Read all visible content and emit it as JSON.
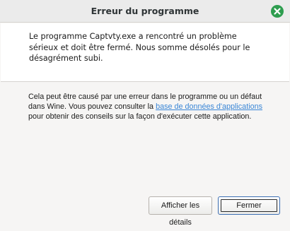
{
  "window": {
    "title": "Erreur du programme"
  },
  "message": {
    "text": "Le programme Captvty.exe a rencontré un problème\nsérieux et doit être fermé. Nous somme désolés pour le\ndésagrément subi."
  },
  "info": {
    "text_before_link": "Cela peut être causé par une erreur dans le programme ou un défaut dans Wine. Vous pouvez consulter la ",
    "link_text": "base de données d'applications",
    "text_after_link": " pour obtenir des conseils sur la façon d'exécuter cette application."
  },
  "buttons": {
    "details_label": "Afficher les détails",
    "close_label": "Fermer"
  },
  "icons": {
    "close": "close-icon"
  },
  "colors": {
    "close_button": "#2e9d4f",
    "link": "#3a86d6",
    "focus_border": "#3d6fb3"
  }
}
